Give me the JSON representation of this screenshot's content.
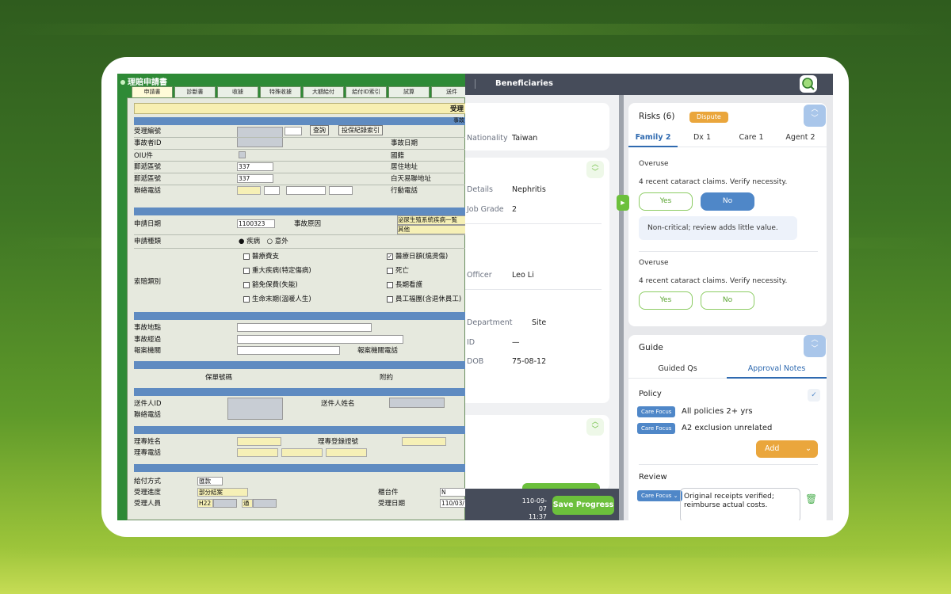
{
  "legacy": {
    "title": "理賠申請書",
    "tabs": [
      "申請書",
      "診斷書",
      "收據",
      "特殊收據",
      "大額給付",
      "給付ID索引",
      "試算",
      "送件"
    ],
    "header_text": "受理",
    "section1_header": "事故",
    "rows": [
      {
        "label": "受理編號",
        "right": ""
      },
      {
        "label": "事故者ID",
        "right": "事故日期"
      },
      {
        "label": "OIU件",
        "right": "國籍"
      },
      {
        "label": "郵遞區號",
        "value": "337",
        "right": "居住地址"
      },
      {
        "label": "郵遞區號",
        "value": "337",
        "right": "白天易聯地址"
      },
      {
        "label": "聯絡電話",
        "right": "行動電話"
      }
    ],
    "query_btn": "查詢",
    "history_btn": "投保紀錄索引",
    "apply_date_label": "申請日期",
    "apply_date_value": "1100323",
    "cause_label": "事故原因",
    "cause_value1": "泌尿生殖系統疾病一覧",
    "cause_value2": "其他",
    "apply_type_label": "申請種類",
    "apply_type_opt1": "疾病",
    "apply_type_opt2": "意外",
    "claim_type_label": "索賠類別",
    "claim_items": [
      {
        "label": "醫療費支",
        "checked": false
      },
      {
        "label": "醫療日額(燒燙傷)",
        "checked": true
      },
      {
        "label": "重大疾病(特定傷病)",
        "checked": false
      },
      {
        "label": "死亡",
        "checked": false
      },
      {
        "label": "豁免保費(失能)",
        "checked": false
      },
      {
        "label": "長期看護",
        "checked": false
      },
      {
        "label": "生命末期(溫暖人生)",
        "checked": false
      },
      {
        "label": "員工福團(含退休員工)",
        "checked": false
      }
    ],
    "accident_place": "事故地點",
    "accident_process": "事故經過",
    "report_agency": "報案機關",
    "report_phone": "報案機關電話",
    "policy_no": "保單號碼",
    "rider": "附約",
    "sender_id": "送件人ID",
    "sender_name": "送件人姓名",
    "sender_phone": "聯絡電話",
    "agent_name": "理專姓名",
    "agent_reg": "理專登錄證號",
    "agent_phone": "理專電話",
    "pay_method": "給付方式",
    "pay_method_value": "匯款",
    "progress_label": "受理進度",
    "progress_value": "部分結案",
    "counter_label": "櫃台件",
    "counter_value": "N",
    "handler_label": "受理人員",
    "handler_value": "H22",
    "handler_extra": "通",
    "accept_date_label": "受理日期",
    "accept_date_value": "110/03/"
  },
  "middle": {
    "header_title": "Beneficiaries",
    "nationality_label": "Nationality",
    "nationality_value": "Taiwan",
    "details_label": "Details",
    "details_value": "Nephritis",
    "job_label": "Job Grade",
    "job_value": "2",
    "officer_label": "Officer",
    "officer_value": "Leo Li",
    "dept_label": "Department",
    "dept_value": "Site",
    "id_label": "ID",
    "id_value": "—",
    "dob_label": "DOB",
    "dob_value": "75-08-12",
    "footer_date": "110-09-07",
    "footer_time": "11:37",
    "save_label": "Save Progress"
  },
  "risks": {
    "title": "Risks (6)",
    "badge": "Dispute",
    "tabs": [
      "Family 2",
      "Dx 1",
      "Care 1",
      "Agent 2"
    ],
    "items": [
      {
        "heading": "Overuse",
        "text": "4 recent cataract claims. Verify necessity.",
        "yes": "Yes",
        "no": "No",
        "note": "Non-critical; review adds little value."
      },
      {
        "heading": "Overuse",
        "text": "4 recent cataract claims. Verify necessity.",
        "yes": "Yes",
        "no": "No"
      }
    ]
  },
  "guide": {
    "title": "Guide",
    "tabs": [
      "Guided Qs",
      "Approval Notes"
    ],
    "policy_title": "Policy",
    "policy_items": [
      {
        "tag": "Care Focus",
        "text": "All policies 2+ yrs"
      },
      {
        "tag": "Care Focus",
        "text": "A2 exclusion unrelated"
      }
    ],
    "add_label": "Add",
    "review_title": "Review",
    "review_tag": "Care Focus",
    "review_text": "Original receipts verified; reimburse actual costs."
  },
  "colors": {
    "accent_green": "#6cc03c",
    "accent_blue": "#4f87c8",
    "accent_orange": "#eaa63c",
    "header_dark": "#464c5a"
  }
}
